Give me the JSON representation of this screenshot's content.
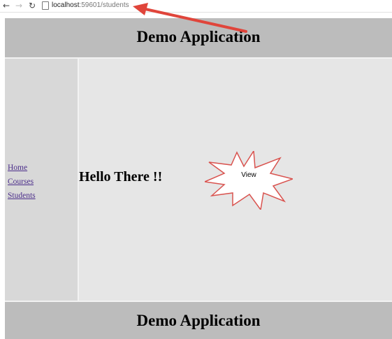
{
  "browser": {
    "url_host": "localhost",
    "url_rest": ":59601/students",
    "nav_icons": [
      "back-icon",
      "forward-icon",
      "reload-icon",
      "page-icon"
    ]
  },
  "page": {
    "header_title": "Demo Application",
    "footer_title": "Demo Application",
    "sidebar": {
      "links": [
        {
          "label": "Home"
        },
        {
          "label": "Courses"
        },
        {
          "label": "Students"
        }
      ]
    },
    "content": {
      "greeting": "Hello There !!",
      "callout_label": "View"
    }
  },
  "colors": {
    "header_bg": "#bcbcbc",
    "sidebar_bg": "#d8d8d8",
    "content_bg": "#e6e6e6",
    "link": "#4b2d8a",
    "callout_border": "#d9534f",
    "annotation_arrow": "#e0453b"
  }
}
